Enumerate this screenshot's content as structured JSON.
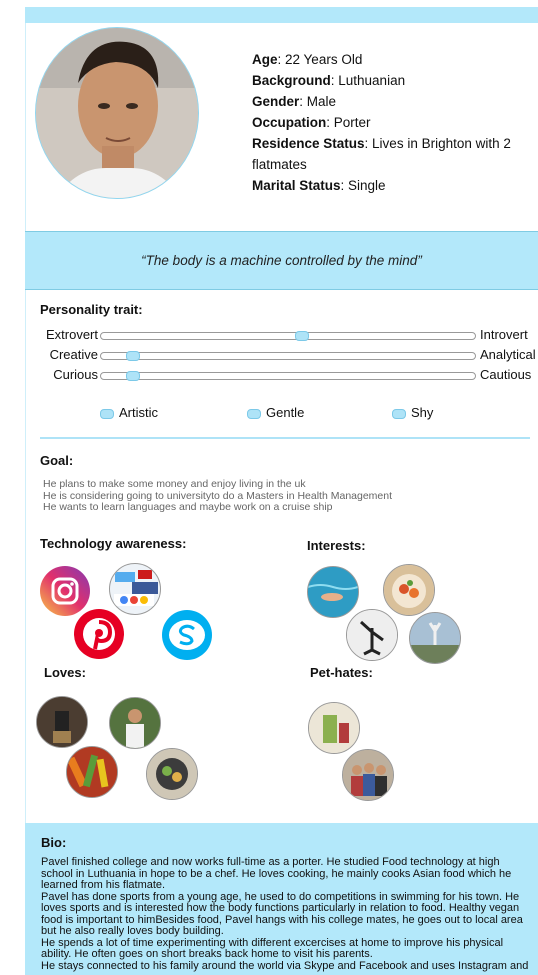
{
  "profile": {
    "age_label": "Age",
    "age": ": 22 Years Old",
    "background_label": "Background",
    "background": ": Luthuanian",
    "gender_label": "Gender",
    "gender": ": Male",
    "occupation_label": "Occupation",
    "occupation": ": Porter",
    "residence_label": "Residence Status",
    "residence": ": Lives in Brighton with 2 flatmates",
    "marital_label": "Marital Status",
    "marital": ": Single"
  },
  "quote": "“The body is a machine controlled by the mind”",
  "personality": {
    "heading": "Personality trait:",
    "traits": [
      {
        "left": "Extrovert",
        "right": "Introvert",
        "value": 0.54
      },
      {
        "left": "Creative",
        "right": "Analytical",
        "value": 0.07
      },
      {
        "left": "Curious",
        "right": "Cautious",
        "value": 0.07
      }
    ],
    "tags": [
      "Artistic",
      "Gentle",
      "Shy"
    ]
  },
  "goal": {
    "heading": "Goal:",
    "lines": [
      "He plans to make some money and enjoy living in the uk",
      "He is considering going to universityto do a Masters in Health Management",
      "He wants to learn languages and maybe work on a cruise ship"
    ]
  },
  "tech_heading": "Technology awareness:",
  "interests_heading": "Interests:",
  "loves_heading": "Loves:",
  "pethates_heading": "Pet-hates:",
  "icons": {
    "instagram": "instagram-icon",
    "pinterest": "pinterest-icon",
    "skype": "skype-icon",
    "social": "social-media-collage-icon"
  },
  "bio": {
    "heading": "Bio:",
    "paragraphs": [
      "Pavel finished college and now works full-time as a porter. He studied Food technology at high school in Luthuania in hope to be a chef. He loves cooking, he mainly cooks Asian food which he learned from his flatmate.",
      "Pavel has done sports from a young age, he used to do competitions in swimming for his town. He loves sports and is interested how the body functions particularly in relation to food. Healthy vegan food is important to himBesides food, Pavel hangs with his college mates, he goes out to local area but he also really loves body building.",
      "He spends a lot of time experimenting with different excercises at home to improve his physical ability. He often goes on short breaks back home to visit his parents.",
      "He stays connected to his family around the world via Skype and Facebook and uses Instagram and"
    ]
  },
  "colors": {
    "accent": "#b3e8fa",
    "accent_border": "#7cc9e8",
    "instagram": "#c13584",
    "pinterest": "#e60023",
    "skype": "#00aff0"
  }
}
